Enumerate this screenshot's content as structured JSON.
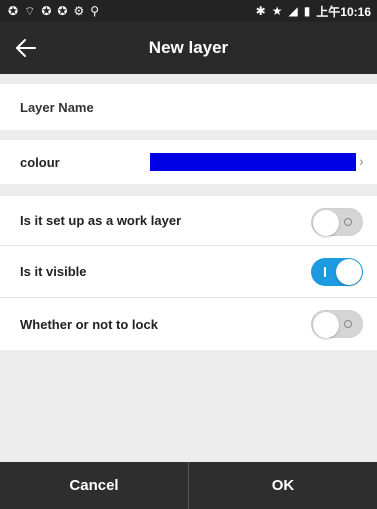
{
  "status_bar": {
    "left_icons": [
      "notification-icon",
      "signal-icon",
      "sync-icon",
      "sync-icon",
      "settings-icon",
      "location-icon"
    ],
    "time": "上午10:16"
  },
  "header": {
    "title": "New layer"
  },
  "layer_name": {
    "placeholder": "Layer Name",
    "value": ""
  },
  "colour": {
    "label": "colour",
    "value": "#0000e6"
  },
  "options": [
    {
      "label": "Is it set up as a work layer",
      "on": false
    },
    {
      "label": "Is it visible",
      "on": true
    },
    {
      "label": "Whether or not to lock",
      "on": false
    }
  ],
  "footer": {
    "cancel_label": "Cancel",
    "ok_label": "OK"
  },
  "colors": {
    "accent": "#1e9ae0",
    "header_bg": "#2a2a2a",
    "background": "#ededed"
  }
}
